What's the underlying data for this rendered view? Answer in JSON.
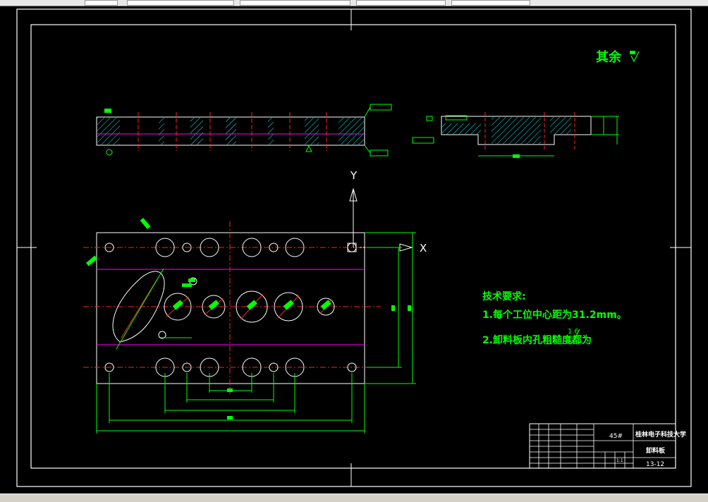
{
  "toolbar": {
    "fields": [
      "",
      "",
      "",
      "",
      ""
    ]
  },
  "drawing": {
    "roughness_note": "其余",
    "axis_y": "Y",
    "axis_x": "X",
    "tech_title": "技术要求:",
    "tech_req_1": "1.每个工位中心距为31.2mm。",
    "tech_req_2": "2.卸料板内孔粗糙度都为",
    "roughness_value": "1.6",
    "tech_req_2_end": ".",
    "title_block": {
      "material": "45#",
      "school": "桂林电子科技大学",
      "part_name": "卸料板",
      "drawing_no": "13-12",
      "scale": "1:1"
    }
  },
  "colors": {
    "frame": "#ffffff",
    "outline": "#ffffff",
    "hatch": "#00ffff",
    "center": "#ff2020",
    "dimension": "#00ff00",
    "annotation": "#00ff00",
    "magenta": "#ff00ff",
    "highlight": "#ffff00"
  }
}
